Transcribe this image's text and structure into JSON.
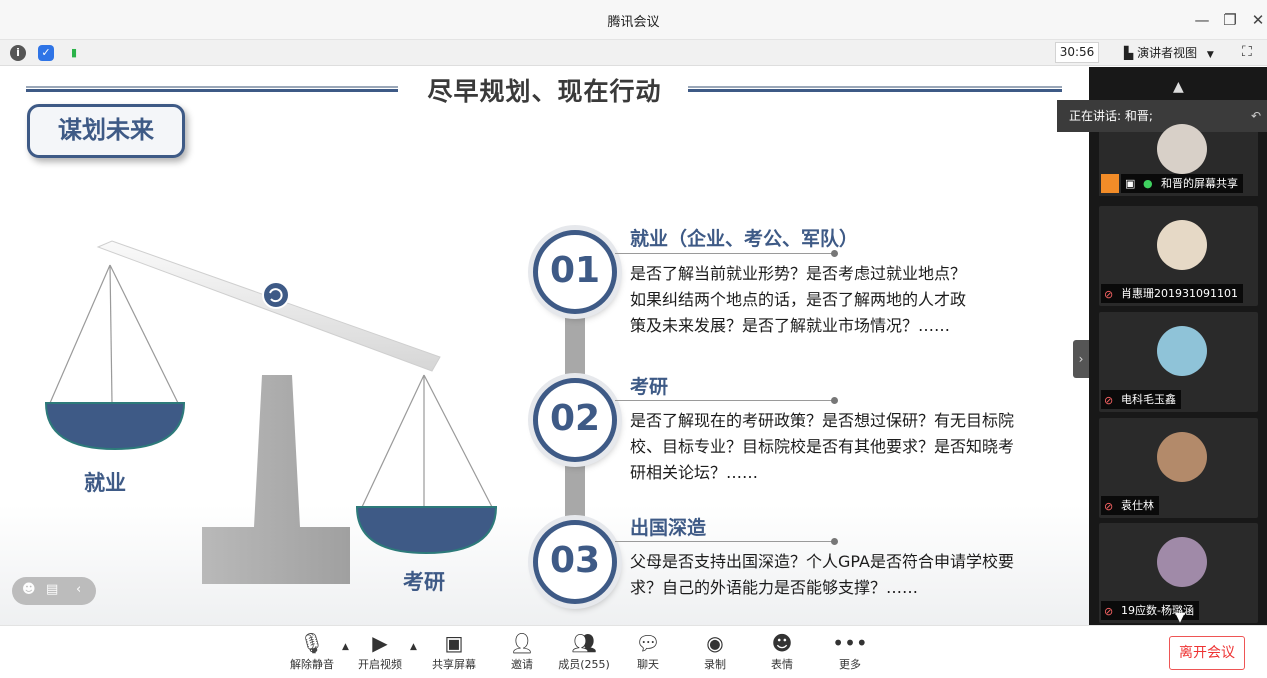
{
  "window": {
    "title": "腾讯会议"
  },
  "toolbar": {
    "timer": "30:56",
    "view_mode": "演讲者视图"
  },
  "slide": {
    "title": "尽早规划、现在行动",
    "badge": "谋划未来",
    "left_label": "就业",
    "right_label": "考研",
    "items": [
      {
        "num": "01",
        "head": "就业（企业、考公、军队）",
        "text": [
          "是否了解当前就业形势？是否考虑过就业地点？",
          "如果纠结两个地点的话，是否了解两地的人才政",
          "策及未来发展？是否了解就业市场情况？……"
        ]
      },
      {
        "num": "02",
        "head": "考研",
        "text": [
          "是否了解现在的考研政策？是否想过保研？有无目标院",
          "校、目标专业？目标院校是否有其他要求？是否知晓考",
          "研相关论坛？……"
        ]
      },
      {
        "num": "03",
        "head": "出国深造",
        "text": [
          "父母是否支持出国深造？个人GPA是否符合申请学校要",
          "求？自己的外语能力是否能够支撑？……"
        ]
      }
    ]
  },
  "sidebar": {
    "speaking": "正在讲话: 和晋;",
    "participants": [
      {
        "name": "和晋的屏幕共享"
      },
      {
        "name": "肖惠珊201931091101"
      },
      {
        "name": "电科毛玉鑫"
      },
      {
        "name": "袁仕林"
      },
      {
        "name": "19应数-杨璐涵"
      }
    ]
  },
  "bottombar": {
    "buttons": [
      "解除静音",
      "开启视频",
      "共享屏幕",
      "邀请",
      "成员(255)",
      "聊天",
      "录制",
      "表情",
      "更多"
    ],
    "leave": "离开会议"
  }
}
